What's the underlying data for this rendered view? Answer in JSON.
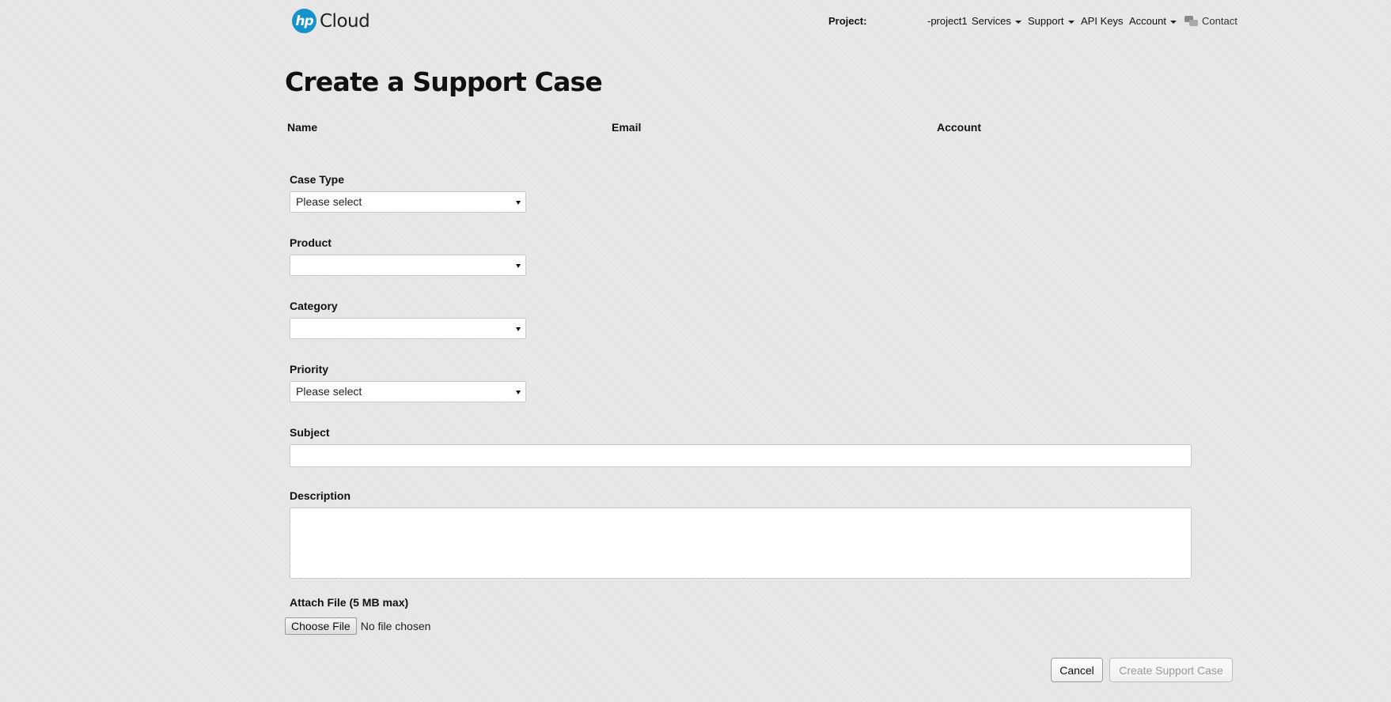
{
  "header": {
    "logo_mark": "hp",
    "logo_text": "Cloud",
    "project_label": "Project:",
    "project_name": "-project1",
    "nav": {
      "services": "Services",
      "support": "Support",
      "api_keys": "API Keys",
      "account": "Account",
      "contact": "Contact"
    },
    "icons": {
      "logo": "hp-logo-icon",
      "caret": "caret-down-icon",
      "contact": "chat-bubbles-icon"
    },
    "colors": {
      "logo_blue": "#1592c9"
    }
  },
  "page": {
    "title": "Create a Support Case"
  },
  "info": {
    "name_label": "Name",
    "email_label": "Email",
    "account_label": "Account"
  },
  "form": {
    "case_type": {
      "label": "Case Type",
      "value": "Please select"
    },
    "product": {
      "label": "Product",
      "value": ""
    },
    "category": {
      "label": "Category",
      "value": ""
    },
    "priority": {
      "label": "Priority",
      "value": "Please select"
    },
    "subject": {
      "label": "Subject",
      "value": ""
    },
    "description": {
      "label": "Description",
      "value": ""
    },
    "attach": {
      "label": "Attach File (5 MB max)",
      "button": "Choose File",
      "status": "No file chosen"
    }
  },
  "actions": {
    "cancel": "Cancel",
    "create": "Create Support Case"
  }
}
